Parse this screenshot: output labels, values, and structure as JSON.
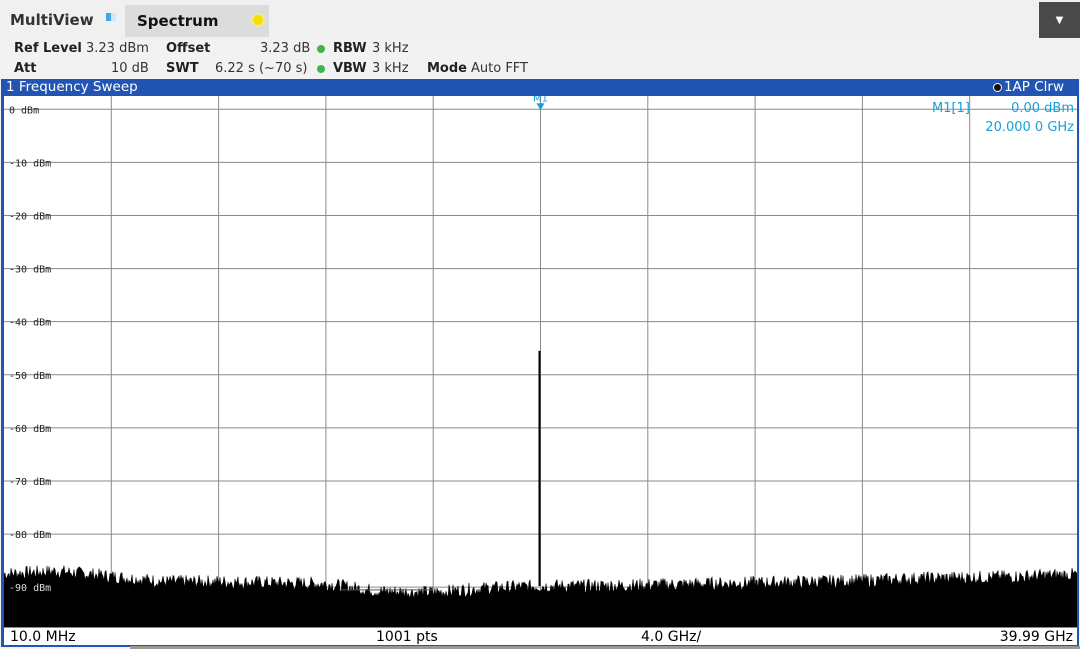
{
  "tabs": {
    "multiview_label": "MultiView",
    "spectrum_label": "Spectrum"
  },
  "menu": {
    "icon": "dropdown-arrow-icon",
    "glyph": "▼"
  },
  "settings": {
    "ref_level_label": "Ref Level",
    "ref_level_value": "3.23 dBm",
    "offset_label": "Offset",
    "offset_value": "3.23 dB",
    "rbw_label": "RBW",
    "rbw_value": "3 kHz",
    "att_label": "Att",
    "att_value": "10 dB",
    "swt_label": "SWT",
    "swt_value": "6.22 s (~70 s)",
    "vbw_label": "VBW",
    "vbw_value": "3 kHz",
    "mode_label": "Mode",
    "mode_value": "Auto FFT",
    "indicator_color": "#41b34a"
  },
  "window": {
    "title": "1 Frequency Sweep",
    "trace_label": "1AP Clrw",
    "frame_color": "#2255b3"
  },
  "marker": {
    "tag": "M1",
    "readout_label": "M1[1]",
    "readout_level": "0.00 dBm",
    "readout_freq": "20.000 0 GHz",
    "color": "#17a0d8"
  },
  "status": {
    "start": "10.0 MHz",
    "points": "1001 pts",
    "span_per_div": "4.0 GHz/",
    "stop": "39.99 GHz"
  },
  "chart_data": {
    "type": "line",
    "xlabel": "",
    "ylabel": "",
    "x_range_ghz": [
      0.01,
      39.99
    ],
    "ylim": [
      -97.5,
      2.5
    ],
    "y_ticks": [
      {
        "value": 0,
        "label": "0 dBm"
      },
      {
        "value": -10,
        "label": "-10 dBm"
      },
      {
        "value": -20,
        "label": "-20 dBm"
      },
      {
        "value": -30,
        "label": "-30 dBm"
      },
      {
        "value": -40,
        "label": "-40 dBm"
      },
      {
        "value": -50,
        "label": "-50 dBm"
      },
      {
        "value": -60,
        "label": "-60 dBm"
      },
      {
        "value": -70,
        "label": "-70 dBm"
      },
      {
        "value": -80,
        "label": "-80 dBm"
      },
      {
        "value": -90,
        "label": "-90 dBm"
      }
    ],
    "x_divisions": 10,
    "grid": true,
    "series": [
      {
        "noise_floor_x_ghz": [
          0,
          2,
          4,
          6,
          8,
          10,
          12,
          14,
          16,
          18,
          20,
          22,
          24,
          26,
          28,
          30,
          32,
          34,
          36,
          38,
          40
        ],
        "noise_floor_dbm": [
          -87.5,
          -87.0,
          -88.0,
          -89.0,
          -89.0,
          -89.2,
          -89.4,
          -90.8,
          -91.0,
          -90.2,
          -89.8,
          -89.8,
          -89.6,
          -89.4,
          -89.2,
          -89.0,
          -88.8,
          -88.4,
          -88.2,
          -88.0,
          -87.6
        ],
        "peak": {
          "x_ghz": 20.0,
          "y_dbm": -45.5
        },
        "color": "#000000"
      }
    ],
    "marker_line_dbm": -90.5,
    "marker_line_x_range_ghz": [
      12.5,
      16.0
    ]
  }
}
